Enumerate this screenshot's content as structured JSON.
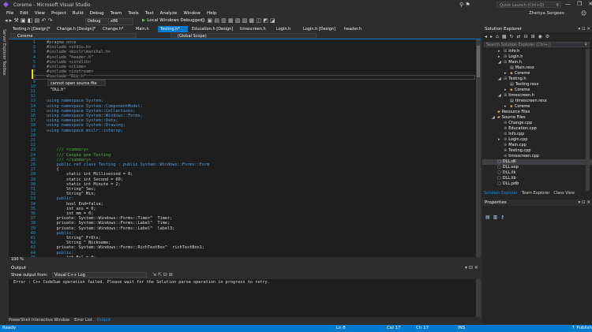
{
  "window": {
    "title": "Coreme - Microsoft Visual Studio",
    "quick_launch_placeholder": "Quick Launch (Ctrl+Q)",
    "user_name": "Zhenya Sergeev",
    "titlebar_icons": "⚲ ⚑",
    "controls": [
      "—",
      "❐",
      "✕"
    ]
  },
  "menu": [
    "File",
    "Edit",
    "View",
    "Project",
    "Build",
    "Debug",
    "Team",
    "Tools",
    "Test",
    "Analyze",
    "Window",
    "Help"
  ],
  "toolbar": {
    "config": "Debug",
    "platform": "x86",
    "debugger": "Local Windows Debugger",
    "left_icons": "◂ ▸ ⚒ ▣ ◧ ▤ ↶ ↷",
    "right_icons": "⚙ ▣ ▤ ▥ ▦ ▧ ▨ ▩ ◫ ◩ ◪"
  },
  "left_strip": [
    "Server Explorer",
    "Toolbox"
  ],
  "doc_tabs": [
    {
      "label": "Testing.h [Design]*",
      "active": false
    },
    {
      "label": "Change.h [Design]*",
      "active": false
    },
    {
      "label": "Change.h*",
      "active": false
    },
    {
      "label": "Main.h",
      "active": false
    },
    {
      "label": "Testing.h*",
      "active": true
    },
    {
      "label": "Education.h [Design]",
      "active": false
    },
    {
      "label": "timescreen.h",
      "active": false
    },
    {
      "label": "Login.h",
      "active": false
    },
    {
      "label": "Login.h [Design]",
      "active": false
    },
    {
      "label": "header.h",
      "active": false
    }
  ],
  "nav": {
    "project": "Coreme",
    "scope": "(Global Scope)"
  },
  "code_lines": [
    {
      "n": "1",
      "t": "#pragma once",
      "c": "pp"
    },
    {
      "n": "2",
      "t": "#include <stdio.h>",
      "c": "pp"
    },
    {
      "n": "3",
      "t": "#include <msclr\\marshal.h>",
      "c": "pp"
    },
    {
      "n": "4",
      "t": "#include \"header.h\"",
      "c": "pp"
    },
    {
      "n": "5",
      "t": "#include <cstdlib>",
      "c": "pp"
    },
    {
      "n": "6",
      "t": "#include <ctime>",
      "c": "pp"
    },
    {
      "n": "7",
      "t": "#include <iostream>",
      "c": "pp"
    },
    {
      "n": "8",
      "t": "#include \"DLL.h\"",
      "c": "pp"
    },
    {
      "n": "9",
      "t": "",
      "c": "id"
    },
    {
      "n": "10",
      "t": "",
      "c": "id"
    },
    {
      "n": "11",
      "t": "",
      "c": "id"
    },
    {
      "n": "12",
      "t": "",
      "c": "id"
    },
    {
      "n": "13",
      "t": "using namespace System;",
      "c": "kw"
    },
    {
      "n": "14",
      "t": "using namespace System::ComponentModel;",
      "c": "kw"
    },
    {
      "n": "15",
      "t": "using namespace System::Collections;",
      "c": "kw"
    },
    {
      "n": "16",
      "t": "using namespace System::Windows::Forms;",
      "c": "kw"
    },
    {
      "n": "17",
      "t": "using namespace System::Data;",
      "c": "kw"
    },
    {
      "n": "18",
      "t": "using namespace System::Drawing;",
      "c": "kw"
    },
    {
      "n": "19",
      "t": "using namespace msclr::interop;",
      "c": "kw"
    },
    {
      "n": "20",
      "t": "",
      "c": "id"
    },
    {
      "n": "21",
      "t": "",
      "c": "id"
    },
    {
      "n": "22",
      "t": "",
      "c": "id"
    },
    {
      "n": "23",
      "t": "    /// <summary>",
      "c": "cm"
    },
    {
      "n": "24",
      "t": "    /// Сводка для Testing",
      "c": "cm"
    },
    {
      "n": "25",
      "t": "    /// </summary>",
      "c": "cm"
    },
    {
      "n": "26",
      "t": "    public ref class Testing : public System::Windows::Forms::Form",
      "c": "kw"
    },
    {
      "n": "27",
      "t": "    {",
      "c": "id"
    },
    {
      "n": "28",
      "t": "        static int Millisecond = 0;",
      "c": "id"
    },
    {
      "n": "29",
      "t": "        static int Second = 00;",
      "c": "id"
    },
    {
      "n": "30",
      "t": "        static int Minute = 2;",
      "c": "id"
    },
    {
      "n": "31",
      "t": "        String^ Sec;",
      "c": "id"
    },
    {
      "n": "32",
      "t": "        String^ Min;",
      "c": "id"
    },
    {
      "n": "33",
      "t": "    public:",
      "c": "kw"
    },
    {
      "n": "34",
      "t": "        bool End=false;",
      "c": "id"
    },
    {
      "n": "35",
      "t": "        int ans = 0;",
      "c": "id"
    },
    {
      "n": "36",
      "t": "        int mm = 0;",
      "c": "id"
    },
    {
      "n": "37",
      "t": "    private: System::Windows::Forms::Timer^  Timer;",
      "c": "id"
    },
    {
      "n": "38",
      "t": "    private: System::Windows::Forms::Label^  Time;",
      "c": "id"
    },
    {
      "n": "39",
      "t": "    private: System::Windows::Forms::Label^  label3;",
      "c": "id"
    },
    {
      "n": "40",
      "t": "    public:",
      "c": "kw"
    },
    {
      "n": "41",
      "t": "        String^ FrOts;",
      "c": "id"
    },
    {
      "n": "42",
      "t": "        String ^ Nickname;",
      "c": "id"
    },
    {
      "n": "43",
      "t": "    private: System::Windows::Forms::RichTextBox^  richTextBox1;",
      "c": "id"
    },
    {
      "n": "44",
      "t": "    public:",
      "c": "kw"
    },
    {
      "n": "45",
      "t": "        int Bal = 0;",
      "c": "id"
    }
  ],
  "tooltip": "cannot open source file \"DLL.h\"",
  "zoom": "100 %",
  "output": {
    "title": "Output",
    "show_from_label": "Show output from:",
    "source": "Visual C++ Log",
    "message": "Error : C++ CodeSum operation failed. Please wait for the Solution parse operation in progress to retry."
  },
  "bottom_tabs": [
    {
      "label": "PowerShell Interactive Window",
      "active": false
    },
    {
      "label": "Error List",
      "active": false
    },
    {
      "label": "Output",
      "active": true
    }
  ],
  "status": {
    "ready": "Ready",
    "ln": "Ln 8",
    "col": "Col 17",
    "ch": "Ch 17",
    "ins": "INS",
    "publish": "↑ Publish"
  },
  "solution_explorer": {
    "title": "Solution Explorer",
    "search_placeholder": "Search Solution Explorer (Ctrl+;)",
    "nodes": [
      {
        "label": "Info.h",
        "depth": 2,
        "arrow": "▸",
        "icon": "h"
      },
      {
        "label": "Login.h",
        "depth": 2,
        "arrow": "▸",
        "icon": "h"
      },
      {
        "label": "Main.h",
        "depth": 2,
        "arrow": "◢",
        "icon": "h"
      },
      {
        "label": "Main.resx",
        "depth": 3,
        "arrow": "",
        "icon": "r"
      },
      {
        "label": "Coreme",
        "depth": 3,
        "arrow": "▸",
        "icon": "c"
      },
      {
        "label": "Testing.h",
        "depth": 2,
        "arrow": "◢",
        "icon": "h"
      },
      {
        "label": "Testing.resx",
        "depth": 3,
        "arrow": "",
        "icon": "r"
      },
      {
        "label": "Coreme",
        "depth": 3,
        "arrow": "▸",
        "icon": "c"
      },
      {
        "label": "timescreen.h",
        "depth": 2,
        "arrow": "◢",
        "icon": "h"
      },
      {
        "label": "timescreen.resx",
        "depth": 3,
        "arrow": "",
        "icon": "r"
      },
      {
        "label": "Coreme",
        "depth": 3,
        "arrow": "▸",
        "icon": "c"
      },
      {
        "label": "Resource Files",
        "depth": 1,
        "arrow": "",
        "icon": "f"
      },
      {
        "label": "Source Files",
        "depth": 1,
        "arrow": "◢",
        "icon": "f"
      },
      {
        "label": "Change.cpp",
        "depth": 2,
        "arrow": "",
        "icon": "p"
      },
      {
        "label": "Education.cpp",
        "depth": 2,
        "arrow": "",
        "icon": "p"
      },
      {
        "label": "Info.cpp",
        "depth": 2,
        "arrow": "",
        "icon": "p"
      },
      {
        "label": "Login.cpp",
        "depth": 2,
        "arrow": "▸",
        "icon": "p"
      },
      {
        "label": "Main.cpp",
        "depth": 2,
        "arrow": "",
        "icon": "p"
      },
      {
        "label": "Testing.cpp",
        "depth": 2,
        "arrow": "",
        "icon": "p"
      },
      {
        "label": "timescreen.cpp",
        "depth": 2,
        "arrow": "",
        "icon": "p"
      },
      {
        "label": "DLL.dll",
        "depth": 1,
        "arrow": "",
        "icon": "d",
        "selected": true
      },
      {
        "label": "DLL.exp",
        "depth": 1,
        "arrow": "",
        "icon": "d"
      },
      {
        "label": "DLL.ilk",
        "depth": 1,
        "arrow": "",
        "icon": "d"
      },
      {
        "label": "DLL.lib",
        "depth": 1,
        "arrow": "",
        "icon": "d"
      },
      {
        "label": "DLL.pdb",
        "depth": 1,
        "arrow": "",
        "icon": "d"
      }
    ],
    "tabs": [
      {
        "label": "Solution Explorer",
        "active": true
      },
      {
        "label": "Team Explorer",
        "active": false
      },
      {
        "label": "Class View",
        "active": false
      }
    ]
  },
  "properties": {
    "title": "Properties"
  }
}
